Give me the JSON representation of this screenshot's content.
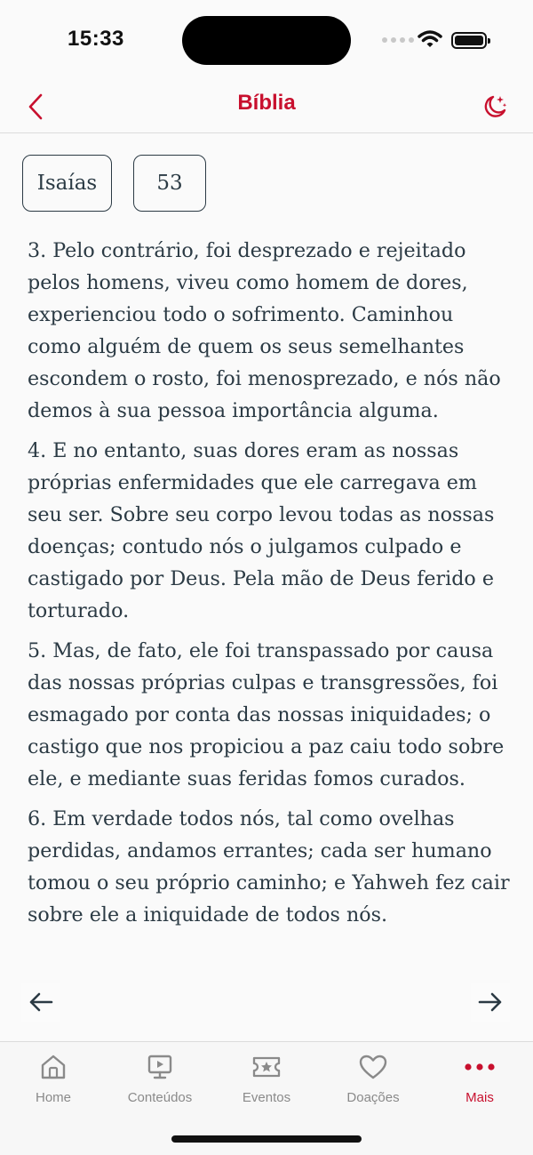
{
  "status_bar": {
    "time": "15:33",
    "icons": [
      "cellular-signal-icon",
      "wifi-icon",
      "battery-icon"
    ]
  },
  "header": {
    "title": "Bíblia",
    "back_icon": "chevron-left-icon",
    "theme_icon": "moon-stars-icon"
  },
  "selectors": {
    "book": "Isaías",
    "chapter": "53"
  },
  "verses": [
    "3. Pelo contrário, foi desprezado e rejeitado pelos homens, viveu como homem de dores, experienciou todo o sofrimento. Caminhou como alguém de quem os seus semelhantes escondem o rosto, foi menosprezado, e nós não demos à sua pessoa importância alguma.",
    "4. E no entanto, suas dores eram as nossas próprias enfermidades que ele carregava em seu ser. Sobre seu corpo levou todas as nossas doenças; contudo nós o julgamos culpado e castigado por Deus. Pela mão de Deus ferido e torturado.",
    "5. Mas, de fato, ele foi transpassado por causa das nossas próprias culpas e transgressões, foi esmagado por conta das nossas iniquidades; o castigo que nos propiciou a paz caiu todo sobre ele, e mediante suas feridas fomos curados.",
    "6. Em verdade todos nós, tal como ovelhas perdidas, andamos errantes; cada ser humano tomou o seu próprio caminho; e Yahweh fez cair sobre ele a iniquidade de todos nós."
  ],
  "navigation": {
    "prev_icon": "arrow-left-icon",
    "next_icon": "arrow-right-icon"
  },
  "tabs": [
    {
      "label": "Home",
      "icon": "home-icon"
    },
    {
      "label": "Conteúdos",
      "icon": "presentation-icon"
    },
    {
      "label": "Eventos",
      "icon": "ticket-star-icon"
    },
    {
      "label": "Doações",
      "icon": "heart-icon"
    },
    {
      "label": "Mais",
      "icon": "more-dots-icon"
    }
  ],
  "active_tab": "Mais",
  "colors": {
    "accent": "#c8102e",
    "text": "#2b3a44",
    "inactive": "#8a8a8a"
  }
}
